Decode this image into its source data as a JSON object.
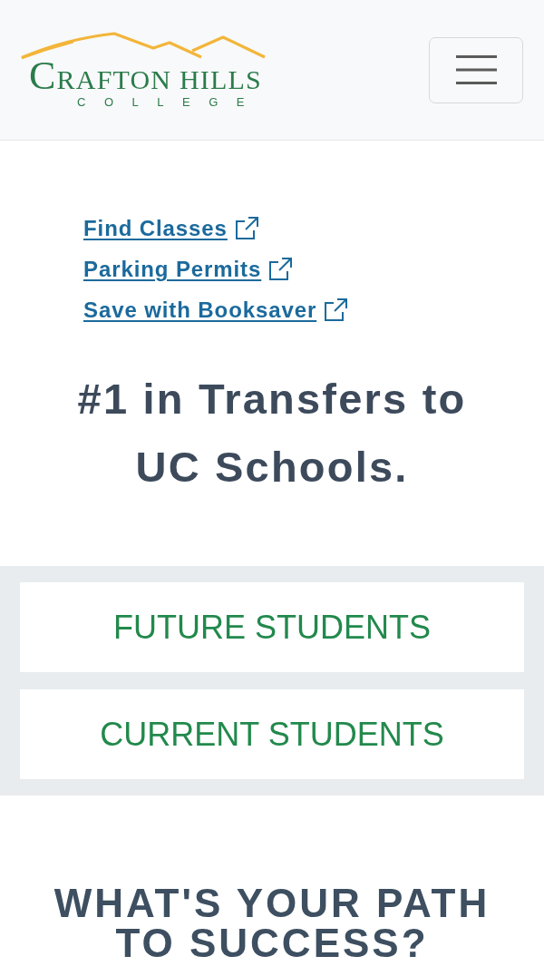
{
  "header": {
    "logo": {
      "name": "CRAFTON HILLS",
      "subtitle": "COLLEGE"
    }
  },
  "quick_links": [
    {
      "label": "Find Classes",
      "external": true
    },
    {
      "label": "Parking Permits",
      "external": true
    },
    {
      "label": "Save with Booksaver",
      "external": true
    }
  ],
  "tagline": "#1 in Transfers to UC Schools.",
  "audience_buttons": [
    {
      "label": "FUTURE STUDENTS"
    },
    {
      "label": "CURRENT STUDENTS"
    }
  ],
  "path_heading": "WHAT'S YOUR PATH TO SUCCESS?"
}
